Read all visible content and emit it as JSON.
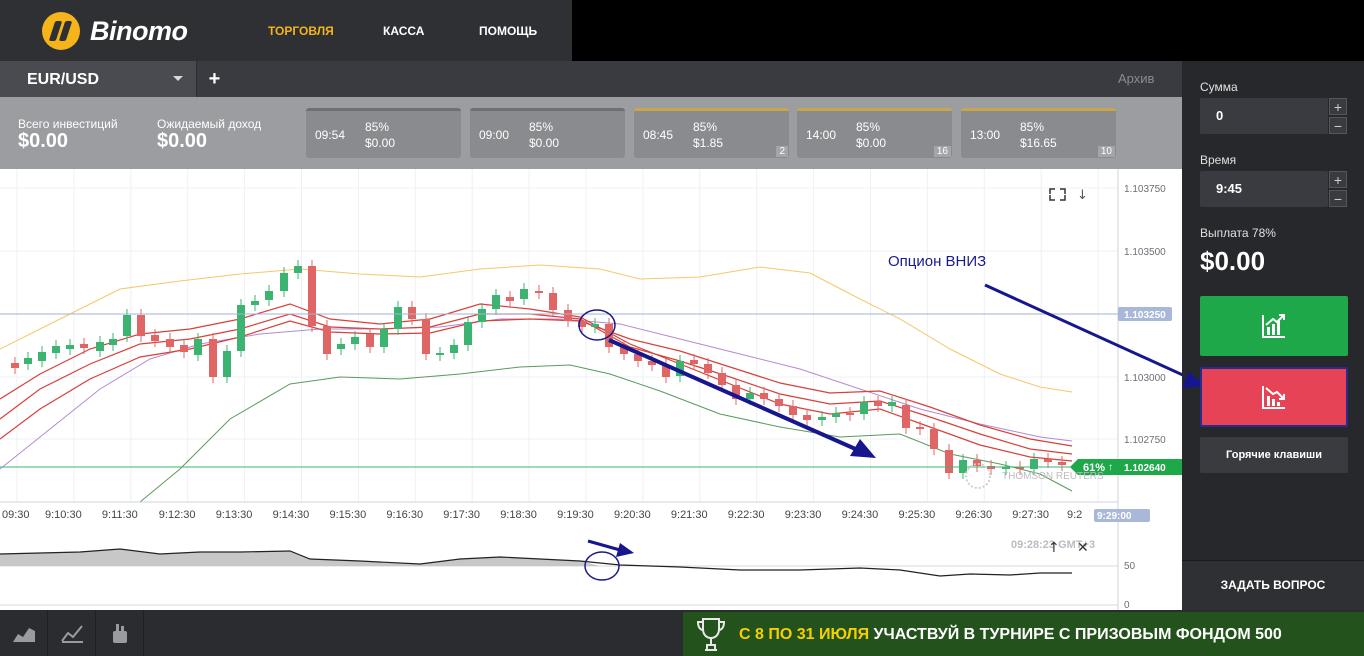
{
  "brand": {
    "name": "Binomo",
    "accent": "#f5b41a"
  },
  "nav": {
    "trading": "ТОРГОВЛЯ",
    "cashier": "КАССА",
    "help": "ПОМОЩЬ"
  },
  "instrument": {
    "name": "EUR/USD",
    "add_label": "+",
    "archive_label": "Архив"
  },
  "summary": {
    "total_invest_label": "Всего инвестиций",
    "total_invest_value": "$0.00",
    "expected_income_label": "Ожидаемый доход",
    "expected_income_value": "$0.00"
  },
  "deals": [
    {
      "time": "09:54",
      "percent": "85%",
      "amount": "$0.00",
      "count": ""
    },
    {
      "time": "09:00",
      "percent": "85%",
      "amount": "$0.00",
      "count": ""
    },
    {
      "time": "08:45",
      "percent": "85%",
      "amount": "$1.85",
      "count": "2"
    },
    {
      "time": "14:00",
      "percent": "85%",
      "amount": "$0.00",
      "count": "16"
    },
    {
      "time": "13:00",
      "percent": "85%",
      "amount": "$16.65",
      "count": "10"
    }
  ],
  "panel": {
    "amount_label": "Сумма",
    "amount_value": "0",
    "time_label": "Время",
    "time_value": "9:45",
    "payout_label": "Выплата 78%",
    "payout_value": "$0.00",
    "hotkeys_label": "Горячие клавиши",
    "ask_label": "ЗАДАТЬ ВОПРОС",
    "plus": "+",
    "minus": "−"
  },
  "chart": {
    "price_ticks": [
      "1.103750",
      "1.103500",
      "1.103250",
      "1.103000",
      "1.102750"
    ],
    "current_price": "1.102640",
    "marked_price": "1.103250",
    "up_percent": "61%",
    "time_ticks": [
      "09:30",
      "9:10:30",
      "9:11:30",
      "9:12:30",
      "9:13:30",
      "9:14:30",
      "9:15:30",
      "9:16:30",
      "9:17:30",
      "9:18:30",
      "9:19:30",
      "9:20:30",
      "9:21:30",
      "9:22:30",
      "9:23:30",
      "9:24:30",
      "9:25:30",
      "9:26:30",
      "9:27:30",
      "9:2"
    ],
    "expiry_time": "9:29:00",
    "clock": "09:28:23 GMT+3",
    "osc_ticks": [
      "50",
      "0"
    ],
    "annotation": "Опцион ВНИЗ",
    "watermark": "THOMSON REUTERS",
    "colors": {
      "up": "#3cb371",
      "down": "#e06666",
      "current": "#1fa84a"
    }
  },
  "banner": {
    "part1": "С 8 ПО 31 ИЮЛЯ",
    "part2": "УЧАСТВУЙ В ТУРНИРЕ С ПРИЗОВЫМ ФОНДОМ 500"
  }
}
